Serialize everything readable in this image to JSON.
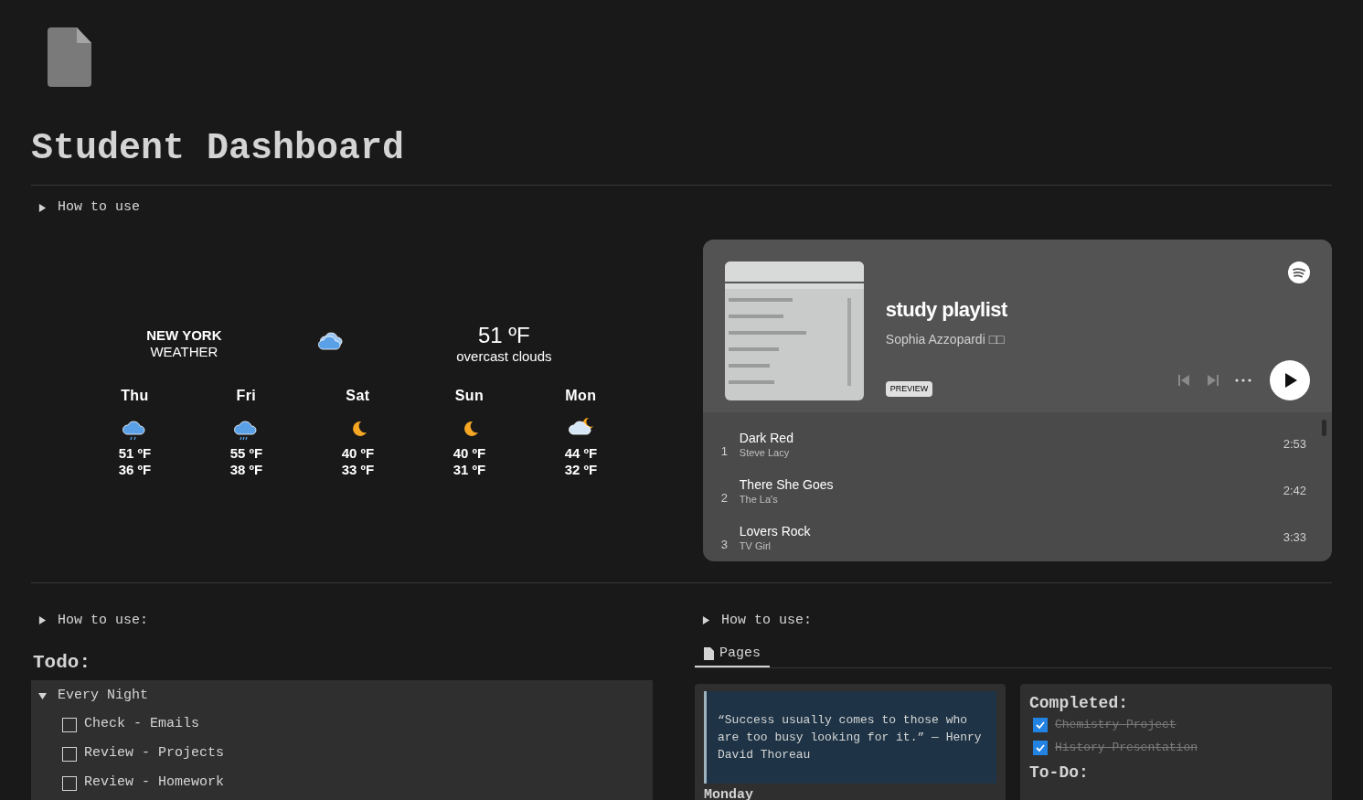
{
  "page": {
    "title": "Student Dashboard",
    "toggle": {
      "label": "How to use",
      "expanded": false
    }
  },
  "weather": {
    "city": "NEW YORK",
    "subtitle": "WEATHER",
    "current": {
      "kind": "cloud",
      "temperature": "51 ºF",
      "condition": "overcast clouds"
    },
    "forecast": [
      {
        "day": "Thu",
        "kind": "rain-light",
        "high": "51 ºF",
        "low": "36 ºF"
      },
      {
        "day": "Fri",
        "kind": "rain",
        "high": "55 ºF",
        "low": "38 ºF"
      },
      {
        "day": "Sat",
        "kind": "moon",
        "high": "40 ºF",
        "low": "33 ºF"
      },
      {
        "day": "Sun",
        "kind": "moon",
        "high": "40 ºF",
        "low": "31 ºF"
      },
      {
        "day": "Mon",
        "kind": "cloud-moon",
        "high": "44 ºF",
        "low": "32 ºF"
      }
    ]
  },
  "player": {
    "title": "study playlist",
    "owner": "Sophia Azzopardi □□",
    "badge": "PREVIEW",
    "tracks": [
      {
        "number": "1",
        "title": "Dark Red",
        "artist": "Steve Lacy",
        "duration": "2:53"
      },
      {
        "number": "2",
        "title": "There She Goes",
        "artist": "The La's",
        "duration": "2:42"
      },
      {
        "number": "3",
        "title": "Lovers Rock",
        "artist": "TV Girl",
        "duration": "3:33"
      }
    ]
  },
  "todo": {
    "toggle": {
      "label": "How to use:",
      "expanded": false
    },
    "heading": "Todo:",
    "group": {
      "label": "Every Night",
      "expanded": true,
      "items": [
        {
          "label": "Check - Emails",
          "checked": false
        },
        {
          "label": "Review - Projects",
          "checked": false
        },
        {
          "label": "Review - Homework",
          "checked": false
        }
      ]
    }
  },
  "pages": {
    "toggle": {
      "label": "How to use:",
      "expanded": false
    },
    "tabs": [
      {
        "label": "Pages",
        "selected": true
      }
    ],
    "quote": "“Success usually comes to those who are too busy looking for it.” — Henry David Thoreau",
    "day_heading": "Monday",
    "completed": {
      "heading": "Completed:",
      "items": [
        {
          "label": "Chemistry Project",
          "checked": true
        },
        {
          "label": "History Presentation",
          "checked": true
        }
      ]
    },
    "todo_heading": "To-Do:"
  }
}
